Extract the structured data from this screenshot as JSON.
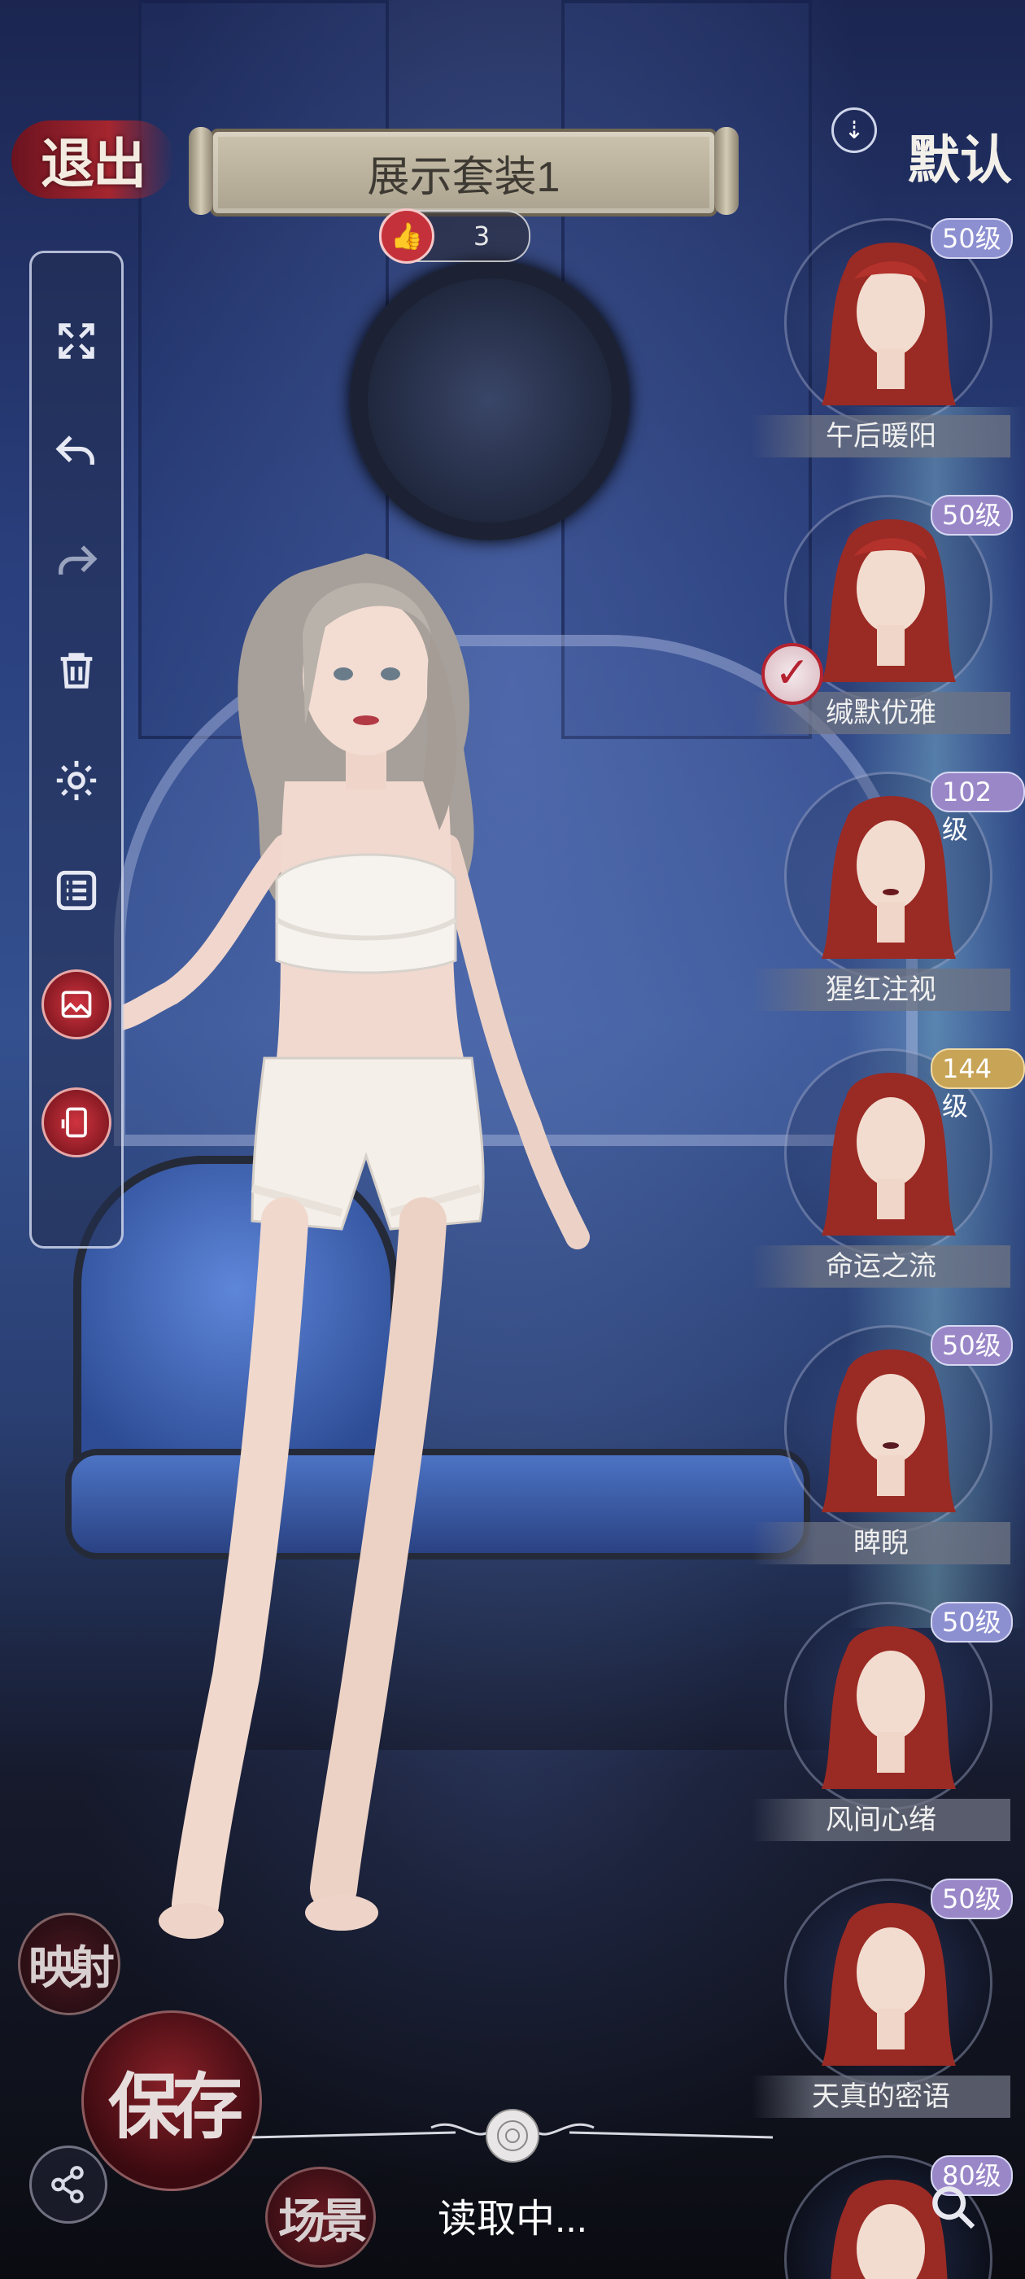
{
  "header": {
    "exit_label": "退出",
    "title": "展示套装1",
    "likes": "3"
  },
  "right_panel": {
    "default_label": "默认",
    "outfits": [
      {
        "name": "午后暖阳",
        "level": "50级",
        "badge": "blue",
        "selected": false
      },
      {
        "name": "缄默优雅",
        "level": "50级",
        "badge": "lavender",
        "selected": true
      },
      {
        "name": "猩红注视",
        "level": "102级",
        "badge": "lavender",
        "selected": false
      },
      {
        "name": "命运之流",
        "level": "144级",
        "badge": "gold",
        "selected": false
      },
      {
        "name": "睥睨",
        "level": "50级",
        "badge": "lavender",
        "selected": false
      },
      {
        "name": "风间心绪",
        "level": "50级",
        "badge": "blue",
        "selected": false
      },
      {
        "name": "天真的密语",
        "level": "50级",
        "badge": "lavender",
        "selected": false
      }
    ],
    "partial_level": "80级"
  },
  "toolbar": {
    "icons": [
      "fullscreen-icon",
      "undo-icon",
      "redo-icon",
      "trash-icon",
      "gear-icon",
      "list-icon",
      "photo-icon",
      "phone-icon"
    ]
  },
  "bottom": {
    "mapping_label": "映射",
    "save_label": "保存",
    "scene_label": "场景",
    "loading_text": "读取中..."
  },
  "colors": {
    "accent_red": "#c4313a",
    "badge_blue": "#8c8fd0",
    "badge_lavender": "#9a87c8",
    "badge_gold": "#c8a457"
  }
}
